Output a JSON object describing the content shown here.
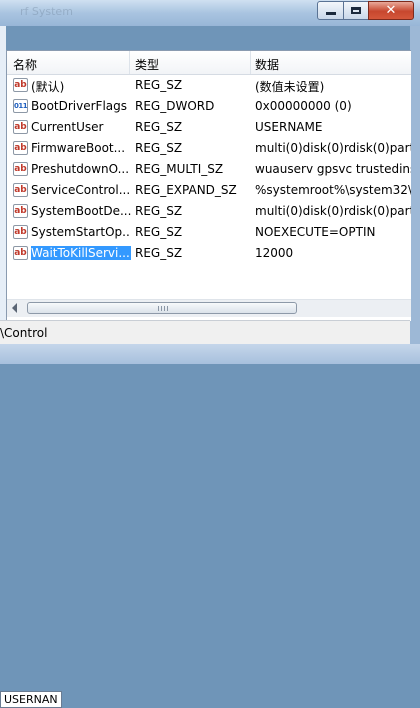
{
  "window": {
    "title": "rf System"
  },
  "headers": {
    "name": "名称",
    "type": "类型",
    "data": "数据"
  },
  "rows": [
    {
      "icon": "ab",
      "name": "(默认)",
      "type": "REG_SZ",
      "data": "(数值未设置)"
    },
    {
      "icon": "bin",
      "name": "BootDriverFlags",
      "type": "REG_DWORD",
      "data": "0x00000000 (0)"
    },
    {
      "icon": "ab",
      "name": "CurrentUser",
      "type": "REG_SZ",
      "data": "USERNAME"
    },
    {
      "icon": "ab",
      "name": "FirmwareBoot...",
      "type": "REG_SZ",
      "data": "multi(0)disk(0)rdisk(0)partiti"
    },
    {
      "icon": "ab",
      "name": "PreshutdownO...",
      "type": "REG_MULTI_SZ",
      "data": "wuauserv gpsvc trustedinsta"
    },
    {
      "icon": "ab",
      "name": "ServiceControl...",
      "type": "REG_EXPAND_SZ",
      "data": "%systemroot%\\system32\\sc"
    },
    {
      "icon": "ab",
      "name": "SystemBootDe...",
      "type": "REG_SZ",
      "data": "multi(0)disk(0)rdisk(0)partiti"
    },
    {
      "icon": "ab",
      "name": "SystemStartOp...",
      "type": "REG_SZ",
      "data": " NOEXECUTE=OPTIN"
    },
    {
      "icon": "ab",
      "name": "WaitToKillServi...",
      "type": "REG_SZ",
      "data": "12000",
      "selected": true
    }
  ],
  "status": {
    "path": "\\Control"
  },
  "behind": {
    "text": "USERNAN"
  }
}
